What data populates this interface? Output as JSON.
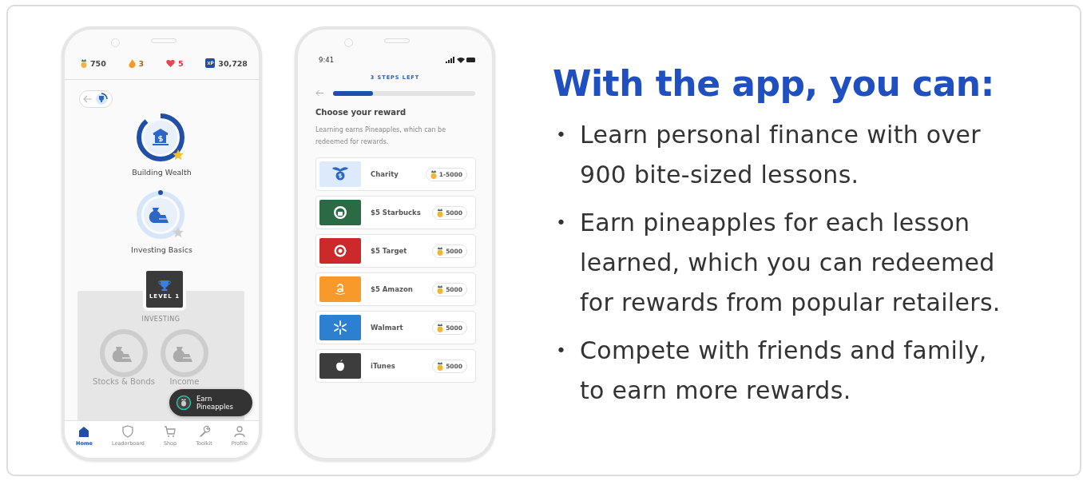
{
  "home_screen": {
    "stats": [
      {
        "kind": "pineapple",
        "value": "750"
      },
      {
        "kind": "flame",
        "value": "3"
      },
      {
        "kind": "heart",
        "value": "5"
      },
      {
        "kind": "xp",
        "value": "30,728"
      }
    ],
    "lessons": [
      {
        "title": "Building Wealth",
        "completed": true,
        "kind": "bank"
      },
      {
        "title": "Investing Basics",
        "completed": false,
        "kind": "bag"
      }
    ],
    "level_badge": "LEVEL 1",
    "section": {
      "title": "INVESTING",
      "lessons": [
        "Stocks & Bonds",
        "Income"
      ]
    },
    "toast": "Earn Pineapples",
    "nav": [
      {
        "label": "Home",
        "kind": "home",
        "selected": true
      },
      {
        "label": "Leaderboard",
        "kind": "shield",
        "selected": false
      },
      {
        "label": "Shop",
        "kind": "cart",
        "selected": false
      },
      {
        "label": "Toolkit",
        "kind": "wrench",
        "selected": false
      },
      {
        "label": "Profile",
        "kind": "person",
        "selected": false
      }
    ]
  },
  "reward_screen": {
    "time": "9:41",
    "steps": "3 STEPS LEFT",
    "progress": {
      "level": 0.28
    },
    "heading": "Choose your reward",
    "description": "Learning earns Pineapples, which can be redeemed for rewards.",
    "rewards": [
      {
        "kind": "charity",
        "name": "Charity",
        "cost": "1-5000"
      },
      {
        "kind": "starbucks",
        "name": "$5 Starbucks",
        "cost": "5000"
      },
      {
        "kind": "target",
        "name": "$5 Target",
        "cost": "5000"
      },
      {
        "kind": "amazon",
        "name": "$5 Amazon",
        "cost": "5000"
      },
      {
        "kind": "walmart",
        "name": "Walmart",
        "cost": "5000"
      },
      {
        "kind": "itunes",
        "name": "iTunes",
        "cost": "5000"
      }
    ]
  },
  "promo": {
    "title": "With the app, you can:",
    "marker": "•",
    "bullets": [
      "Learn personal finance with over 900 bite-sized lessons.",
      "Earn pineapples for each lesson learned, which you can redeemed for rewards from popular retailers.",
      "Compete with friends and family, to earn more rewards."
    ]
  }
}
